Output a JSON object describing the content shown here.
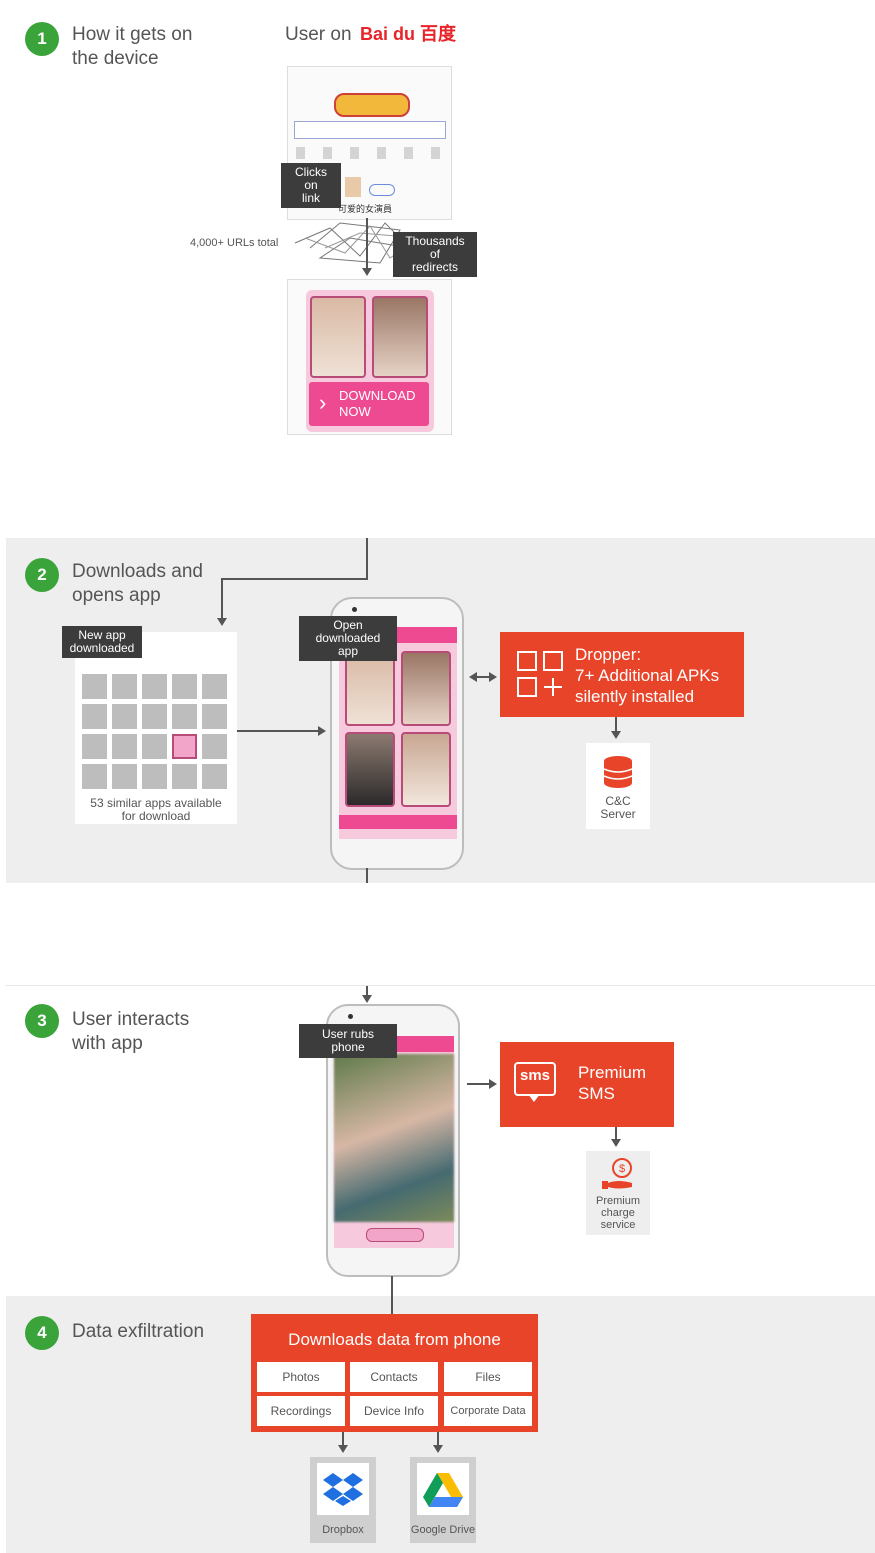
{
  "steps": [
    {
      "num": "1",
      "title": "How it gets on\nthe device"
    },
    {
      "num": "2",
      "title": "Downloads and\nopens app"
    },
    {
      "num": "3",
      "title": "User interacts\nwith app"
    },
    {
      "num": "4",
      "title": "Data exfiltration"
    }
  ],
  "step1": {
    "user_on": "User on",
    "baidu_logo": "Bai du 百度",
    "clicks_on_link": "Clicks on\nlink",
    "urls_total": "4,000+ URLs total",
    "redirects": "Thousands of\nredirects",
    "search_result_text": "可爱的女演員",
    "download_button": "DOWNLOAD\nNOW"
  },
  "step2": {
    "new_app_label": "New app\ndownloaded",
    "similar_apps": "53 similar apps available\nfor download",
    "open_app_label": "Open\ndownloaded app",
    "dropper_title": "Dropper:\n7+ Additional APKs\nsilently installed",
    "cc_server": "C&C\nServer"
  },
  "step3": {
    "user_rubs_label": "User rubs\nphone",
    "premium_sms": "Premium\nSMS",
    "sms_icon_text": "sms",
    "premium_charge": "Premium\ncharge\nservice"
  },
  "step4": {
    "title": "Downloads data from phone",
    "data_items": [
      "Photos",
      "Contacts",
      "Files",
      "Recordings",
      "Device Info",
      "Corporate Data"
    ],
    "dropbox": "Dropbox",
    "google_drive": "Google Drive"
  },
  "colors": {
    "accent_red": "#e8442a",
    "step_green": "#3aa33a",
    "pink": "#ee4a92",
    "band_gray": "#eeeeee"
  }
}
